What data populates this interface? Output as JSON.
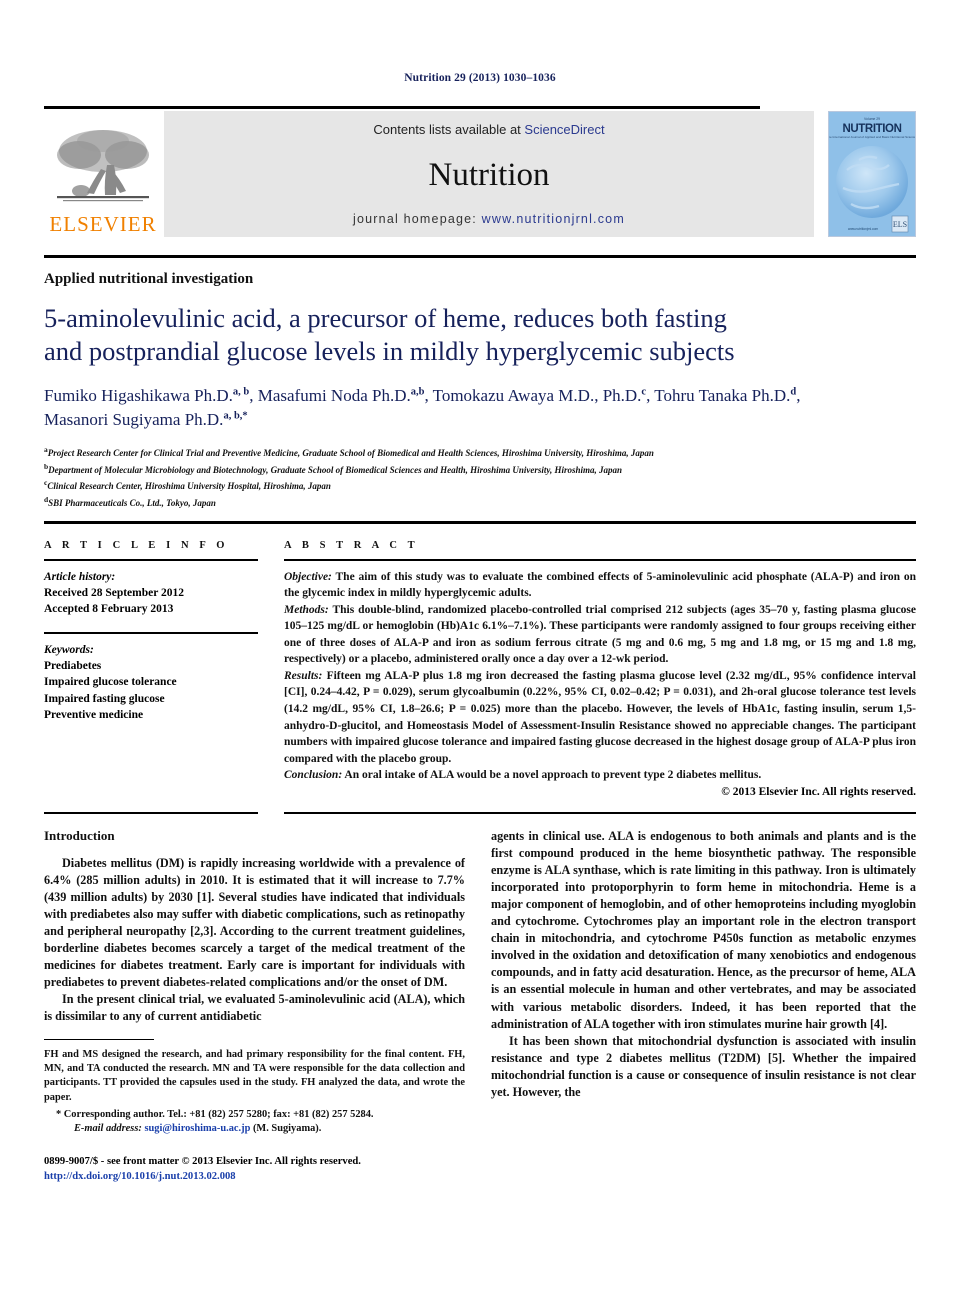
{
  "running_head": "Nutrition 29 (2013) 1030–1036",
  "banner": {
    "contents_prefix": "Contents lists available at ",
    "sciencedirect": "ScienceDirect",
    "journal_name": "Nutrition",
    "homepage_prefix": "journal homepage: ",
    "homepage_url": "www.nutritionjrnl.com",
    "publisher_logo_text": "ELSEVIER",
    "cover_title": "NUTRITION",
    "cover_masthead": "Volume 29",
    "cover_subtitle": "The International Journal of Applied and Basic Nutritional Sciences",
    "cover_footer": "www.nutritionjrnl.com"
  },
  "article": {
    "subject": "Applied nutritional investigation",
    "title": "5-aminolevulinic acid, a precursor of heme, reduces both fasting and postprandial glucose levels in mildly hyperglycemic subjects",
    "authors_line1_html": "Fumiko Higashikawa Ph.D.",
    "authors": [
      {
        "name": "Fumiko Higashikawa Ph.D.",
        "marks": "a, b",
        "sep": ", "
      },
      {
        "name": "Masafumi Noda Ph.D.",
        "marks": "a,b",
        "sep": ", "
      },
      {
        "name": "Tomokazu Awaya M.D., Ph.D.",
        "marks": "c",
        "sep": ", "
      },
      {
        "name": "Tohru Tanaka Ph.D.",
        "marks": "d",
        "sep": ", "
      },
      {
        "name": "Masanori Sugiyama Ph.D.",
        "marks": "a, b,*",
        "sep": ""
      }
    ],
    "affiliations": [
      {
        "mark": "a",
        "text": "Project Research Center for Clinical Trial and Preventive Medicine, Graduate School of Biomedical and Health Sciences, Hiroshima University, Hiroshima, Japan"
      },
      {
        "mark": "b",
        "text": "Department of Molecular Microbiology and Biotechnology, Graduate School of Biomedical Sciences and Health, Hiroshima University, Hiroshima, Japan"
      },
      {
        "mark": "c",
        "text": "Clinical Research Center, Hiroshima University Hospital, Hiroshima, Japan"
      },
      {
        "mark": "d",
        "text": "SBI Pharmaceuticals Co., Ltd., Tokyo, Japan"
      }
    ]
  },
  "article_info": {
    "heading": "A R T I C L E   I N F O",
    "history_label": "Article history:",
    "history": [
      "Received 28 September 2012",
      "Accepted 8 February 2013"
    ],
    "keywords_label": "Keywords:",
    "keywords": [
      "Prediabetes",
      "Impaired glucose tolerance",
      "Impaired fasting glucose",
      "Preventive medicine"
    ]
  },
  "abstract": {
    "heading": "A B S T R A C T",
    "sections": [
      {
        "label": "Objective:",
        "text": " The aim of this study was to evaluate the combined effects of 5-aminolevulinic acid phosphate (ALA-P) and iron on the glycemic index in mildly hyperglycemic adults."
      },
      {
        "label": "Methods:",
        "text": " This double-blind, randomized placebo-controlled trial comprised 212 subjects (ages 35–70 y, fasting plasma glucose 105–125 mg/dL or hemoglobin (Hb)A1c 6.1%–7.1%). These participants were randomly assigned to four groups receiving either one of three doses of ALA-P and iron as sodium ferrous citrate (5 mg and 0.6 mg, 5 mg and 1.8 mg, or 15 mg and 1.8 mg, respectively) or a placebo, administered orally once a day over a 12-wk period."
      },
      {
        "label": "Results:",
        "text": " Fifteen mg ALA-P plus 1.8 mg iron decreased the fasting plasma glucose level (2.32 mg/dL, 95% confidence interval [CI], 0.24–4.42, P = 0.029), serum glycoalbumin (0.22%, 95% CI, 0.02–0.42; P = 0.031), and 2h-oral glucose tolerance test levels (14.2 mg/dL, 95% CI, 1.8–26.6; P = 0.025) more than the placebo. However, the levels of HbA1c, fasting insulin, serum 1,5-anhydro-D-glucitol, and Homeostasis Model of Assessment-Insulin Resistance showed no appreciable changes. The participant numbers with impaired glucose tolerance and impaired fasting glucose decreased in the highest dosage group of ALA-P plus iron compared with the placebo group."
      },
      {
        "label": "Conclusion:",
        "text": " An oral intake of ALA would be a novel approach to prevent type 2 diabetes mellitus."
      }
    ],
    "copyright": "© 2013 Elsevier Inc. All rights reserved."
  },
  "body": {
    "intro_heading": "Introduction",
    "left_paragraphs": [
      "Diabetes mellitus (DM) is rapidly increasing worldwide with a prevalence of 6.4% (285 million adults) in 2010. It is estimated that it will increase to 7.7% (439 million adults) by 2030 [1]. Several studies have indicated that individuals with prediabetes also may suffer with diabetic complications, such as retinopathy and peripheral neuropathy [2,3]. According to the current treatment guidelines, borderline diabetes becomes scarcely a target of the medical treatment of the medicines for diabetes treatment. Early care is important for individuals with prediabetes to prevent diabetes-related complications and/or the onset of DM.",
      "In the present clinical trial, we evaluated 5-aminolevulinic acid (ALA), which is dissimilar to any of current antidiabetic"
    ],
    "right_paragraphs": [
      "agents in clinical use. ALA is endogenous to both animals and plants and is the first compound produced in the heme biosynthetic pathway. The responsible enzyme is ALA synthase, which is rate limiting in this pathway. Iron is ultimately incorporated into protoporphyrin to form heme in mitochondria. Heme is a major component of hemoglobin, and of other hemoproteins including myoglobin and cytochrome. Cytochromes play an important role in the electron transport chain in mitochondria, and cytochrome P450s function as metabolic enzymes involved in the oxidation and detoxification of many xenobiotics and endogenous compounds, and in fatty acid desaturation. Hence, as the precursor of heme, ALA is an essential molecule in human and other vertebrates, and may be associated with various metabolic disorders. Indeed, it has been reported that the administration of ALA together with iron stimulates murine hair growth [4].",
      "It has been shown that mitochondrial dysfunction is associated with insulin resistance and type 2 diabetes mellitus (T2DM) [5]. Whether the impaired mitochondrial function is a cause or consequence of insulin resistance is not clear yet. However, the"
    ],
    "footnote_contributions": "FH and MS designed the research, and had primary responsibility for the final content. FH, MN, and TA conducted the research. MN and TA were responsible for the data collection and participants. TT provided the capsules used in the study. FH analyzed the data, and wrote the paper.",
    "corresponding": "* Corresponding author. Tel.: +81 (82) 257 5280; fax: +81 (82) 257 5284.",
    "email_label": "E-mail address:",
    "email": "sugi@hiroshima-u.ac.jp",
    "email_suffix": " (M. Sugiyama).",
    "issn_line": "0899-9007/$ - see front matter © 2013 Elsevier Inc. All rights reserved.",
    "doi": "http://dx.doi.org/10.1016/j.nut.2013.02.008"
  },
  "colors": {
    "title_blue": "#16215b",
    "link_blue": "#2b3a8f",
    "ref_blue": "#1a3faa",
    "elsevier_orange": "#f08000",
    "banner_gray": "#e6e6e6"
  }
}
